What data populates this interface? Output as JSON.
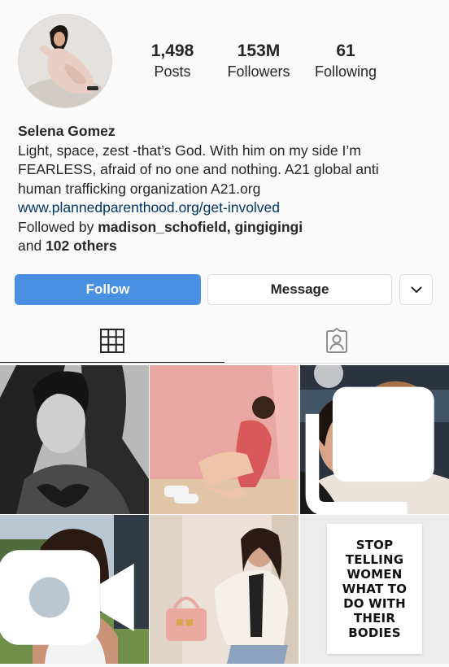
{
  "profile": {
    "name": "Selena Gomez",
    "stats": {
      "posts": {
        "value": "1,498",
        "label": "Posts"
      },
      "followers": {
        "value": "153M",
        "label": "Followers"
      },
      "following": {
        "value": "61",
        "label": "Following"
      }
    },
    "bio_lines": [
      "Light, space, zest -that’s God. With him on my side I’m",
      "FEARLESS, afraid of no one and nothing. A21 global anti",
      "human trafficking organization A21.org"
    ],
    "link": "www.plannedparenthood.org/get-involved",
    "followed_by": {
      "prefix": "Followed by ",
      "users": "madison_schofield, gingigingi",
      "and": "and ",
      "others": "102 others"
    }
  },
  "actions": {
    "follow_label": "Follow",
    "message_label": "Message",
    "more_icon": "chevron-down-icon"
  },
  "tabs": {
    "active": "grid",
    "icons": [
      "grid-icon",
      "tagged-icon"
    ]
  },
  "posts": [
    {
      "description": "black and white portrait",
      "badge": null
    },
    {
      "description": "woman sitting against pink wall",
      "badge": null
    },
    {
      "description": "two women smiling selfie",
      "badge": "carousel-icon"
    },
    {
      "description": "woman in white tank top outdoors",
      "badge": "video-icon"
    },
    {
      "description": "woman in white jacket with pink handbag",
      "badge": null
    },
    {
      "description": "text poster",
      "badge": null,
      "poster_text": "STOP\nTELLING\nWOMEN\nWHAT TO\nDO WITH\nTHEIR\nBODIES"
    }
  ],
  "colors": {
    "follow_button": "#4a90e2",
    "link": "#003569",
    "text": "#262626",
    "border": "#dbdbdb"
  }
}
